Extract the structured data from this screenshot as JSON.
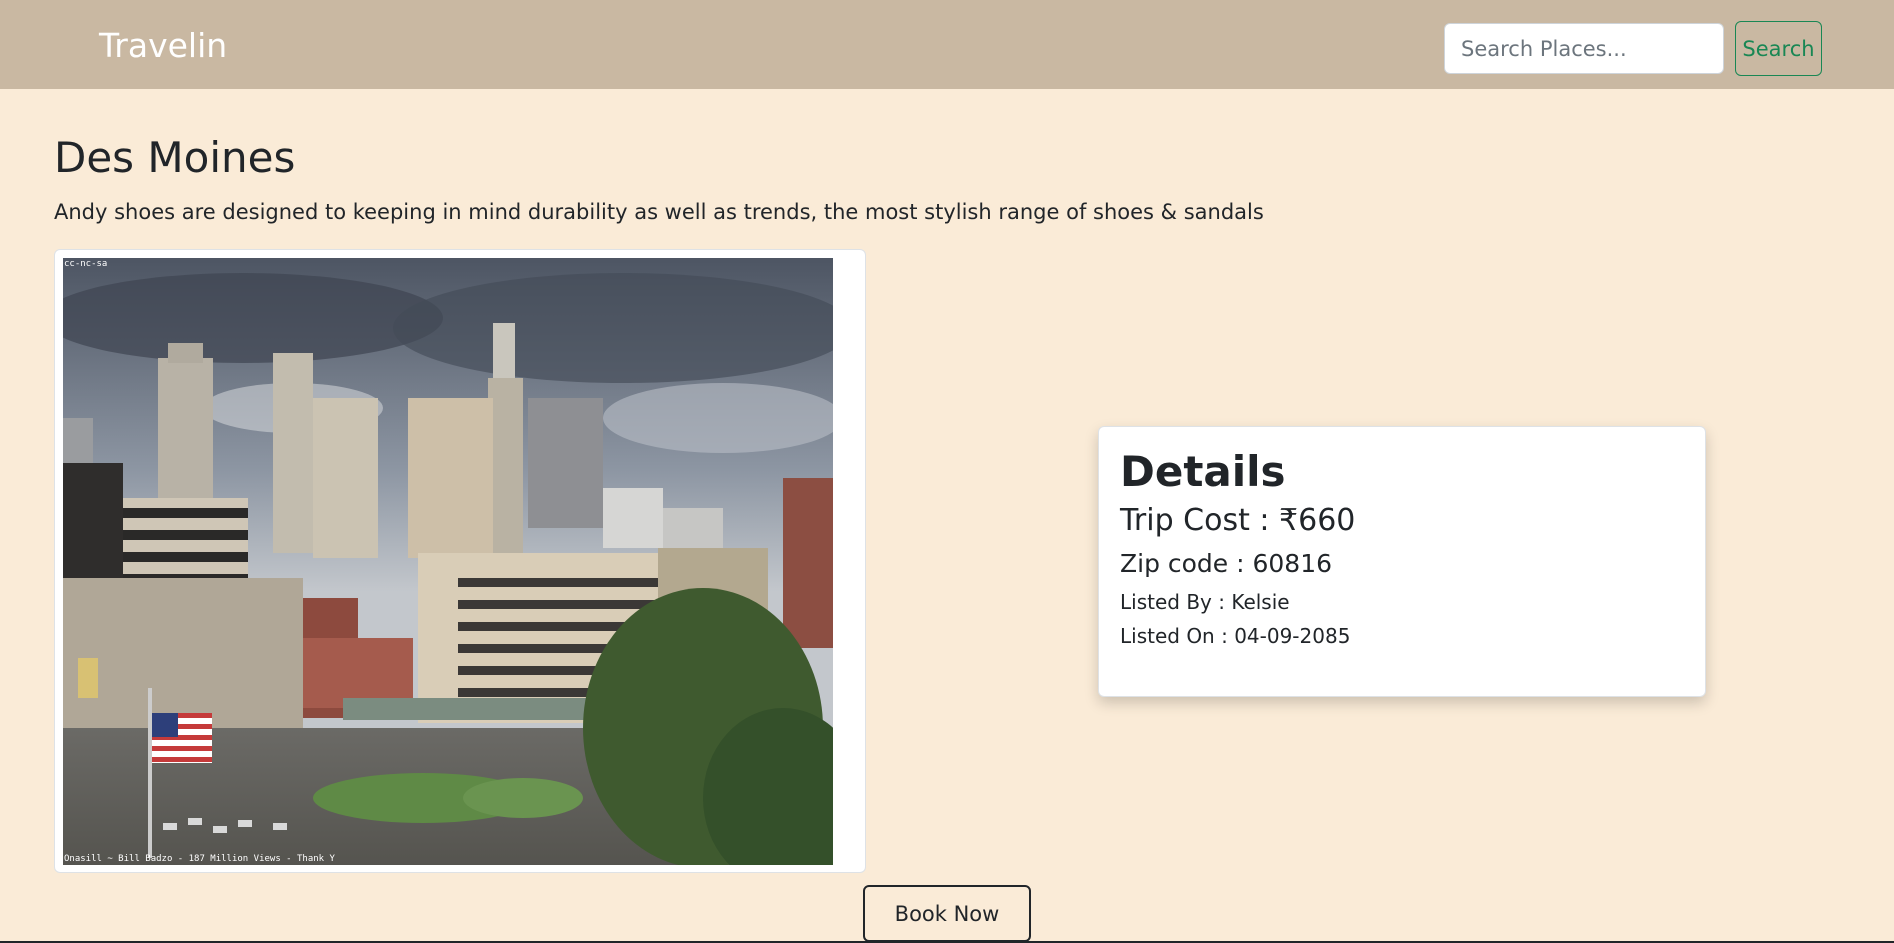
{
  "navbar": {
    "brand": "Travelin",
    "search_placeholder": "Search Places...",
    "search_label": "Search"
  },
  "place": {
    "title": "Des Moines",
    "description": "Andy shoes are designed to keeping in mind durability as well as trends, the most stylish range of shoes & sandals",
    "photo_license": "cc-nc-sa",
    "photo_caption": "Onasill ~ Bill Badzo - 187 Million Views - Thank Y"
  },
  "details": {
    "title": "Details",
    "trip_cost": "Trip Cost : ₹660",
    "zip_code": "Zip code : 60816",
    "listed_by": "Listed By : Kelsie",
    "listed_on": "Listed On : 04-09-2085"
  },
  "actions": {
    "book_label": "Book Now"
  },
  "colors": {
    "page_bg": "#faebd7",
    "navbar_bg": "#c9b8a2",
    "accent": "#198754"
  }
}
